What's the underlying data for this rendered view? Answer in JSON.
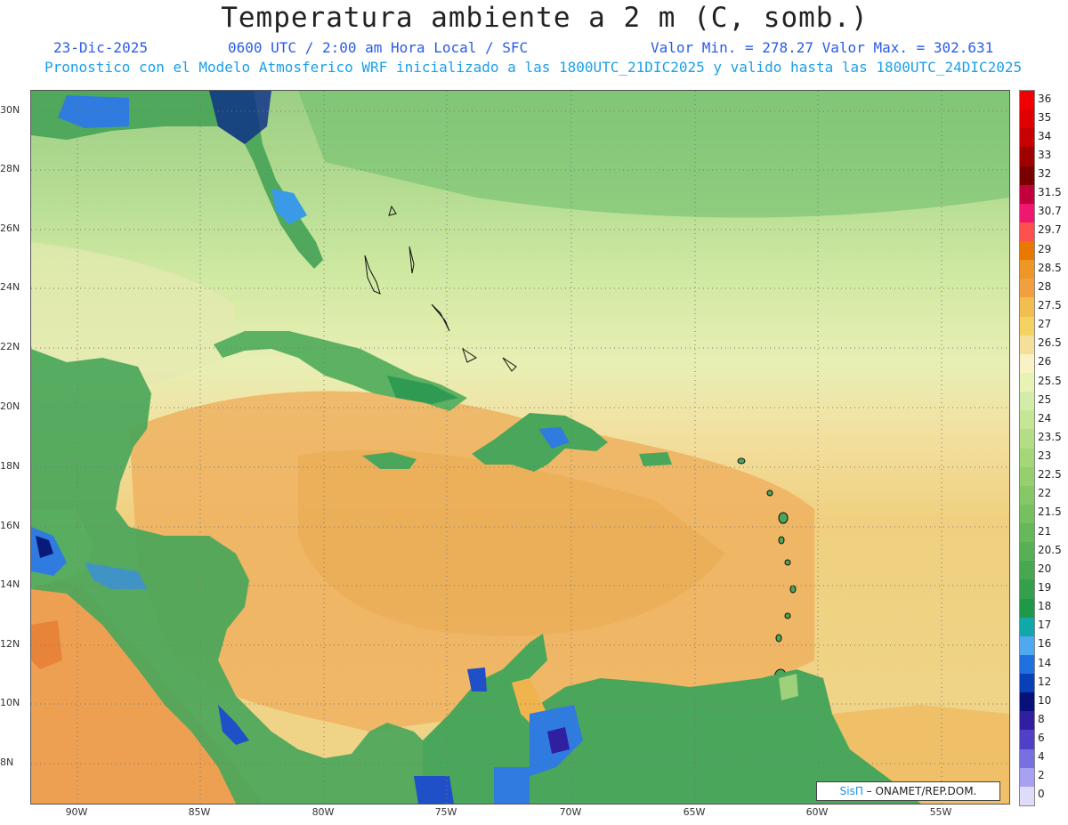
{
  "header": {
    "title": "Temperatura ambiente a 2 m (C, somb.)",
    "date": "23-Dic-2025",
    "time": "0600 UTC / 2:00 am Hora Local / SFC",
    "minmax": "Valor Min. = 278.27  Valor Max. = 302.631",
    "model": "Pronostico con el Modelo Atmosferico WRF inicializado a las 1800UTC_21DIC2025 y valido hasta las  1800UTC_24DIC2025"
  },
  "axes": {
    "lat_labels": [
      "30N",
      "28N",
      "26N",
      "24N",
      "22N",
      "20N",
      "18N",
      "16N",
      "14N",
      "12N",
      "10N",
      "8N"
    ],
    "lon_labels": [
      "90W",
      "85W",
      "80W",
      "75W",
      "70W",
      "65W",
      "60W",
      "55W"
    ]
  },
  "colorbar": {
    "labels": [
      "36",
      "35",
      "34",
      "33",
      "32",
      "31.5",
      "30.7",
      "29.7",
      "29",
      "28.5",
      "28",
      "27.5",
      "27",
      "26.5",
      "26",
      "25.5",
      "25",
      "24",
      "23.5",
      "23",
      "22.5",
      "22",
      "21.5",
      "21",
      "20.5",
      "20",
      "19",
      "18",
      "17",
      "16",
      "14",
      "12",
      "10",
      "8",
      "6",
      "4",
      "2",
      "0"
    ],
    "colors": [
      "#f00000",
      "#e00000",
      "#c80000",
      "#a00000",
      "#7a0000",
      "#c2003c",
      "#f0186e",
      "#ff5050",
      "#e87800",
      "#ee9626",
      "#f0a040",
      "#f2be50",
      "#f4d264",
      "#f4e09a",
      "#f8f2c4",
      "#e8f2b4",
      "#d2ecaa",
      "#c4e696",
      "#b4de86",
      "#a4d67a",
      "#96d06e",
      "#86c866",
      "#76c060",
      "#66b85a",
      "#58b056",
      "#48a852",
      "#34a04e",
      "#20984a",
      "#10a8a8",
      "#50a8f0",
      "#2070e0",
      "#0840b8",
      "#08107a",
      "#3020a0",
      "#5040c8",
      "#7870e0",
      "#a8a0f0",
      "#ddddfa"
    ]
  },
  "credit": {
    "logo": "SisΠ",
    "text": " – ONAMET/REP.DOM."
  },
  "colors": {
    "ocean_warm": "#f0b458",
    "ocean_mild": "#f2d888",
    "atlantic": "#cde8a0",
    "cool_north": "#9ccf84",
    "land": "#4aa65a",
    "highland": "#2f7be0"
  }
}
